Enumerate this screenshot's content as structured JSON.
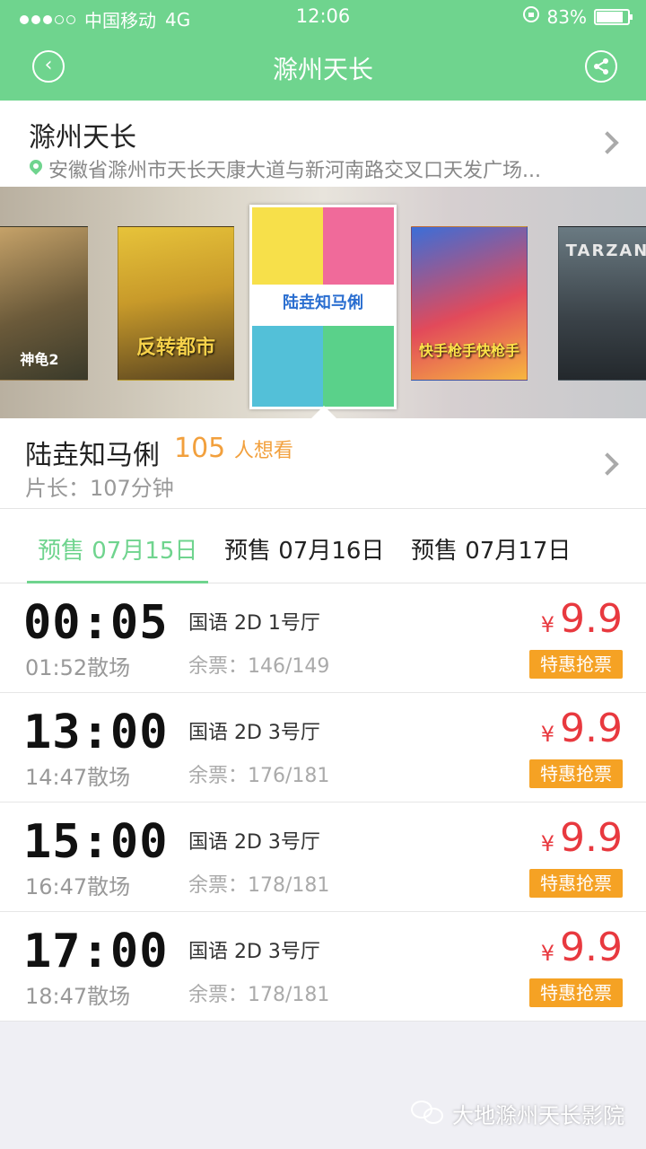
{
  "status_bar": {
    "carrier": "中国移动",
    "network": "4G",
    "time": "12:06",
    "battery": "83%"
  },
  "nav": {
    "title": "滁州天长"
  },
  "cinema": {
    "name": "滁州天长",
    "address": "安徽省滁州市天长天康大道与新河南路交叉口天发广场..."
  },
  "posters": [
    {
      "title": "神龟2"
    },
    {
      "title": "反转都市"
    },
    {
      "title": "陆垚知马俐"
    },
    {
      "title": "快手枪手快枪手"
    },
    {
      "title": "TARZAN"
    }
  ],
  "movie": {
    "name": "陆垚知马俐",
    "want_count": "105",
    "want_label": "人想看",
    "length": "片长：107分钟"
  },
  "tabs": [
    {
      "label": "预售 07月15日",
      "active": true
    },
    {
      "label": "预售 07月16日",
      "active": false
    },
    {
      "label": "预售 07月17日",
      "active": false
    }
  ],
  "sessions": [
    {
      "start": "00:05",
      "end": "01:52散场",
      "lang": "国语 2D  1号厅",
      "remain": "余票：146/149",
      "currency": "¥",
      "price": "9.9",
      "deal": "特惠抢票"
    },
    {
      "start": "13:00",
      "end": "14:47散场",
      "lang": "国语 2D  3号厅",
      "remain": "余票：176/181",
      "currency": "¥",
      "price": "9.9",
      "deal": "特惠抢票"
    },
    {
      "start": "15:00",
      "end": "16:47散场",
      "lang": "国语 2D  3号厅",
      "remain": "余票：178/181",
      "currency": "¥",
      "price": "9.9",
      "deal": "特惠抢票"
    },
    {
      "start": "17:00",
      "end": "18:47散场",
      "lang": "国语 2D  3号厅",
      "remain": "余票：178/181",
      "currency": "¥",
      "price": "9.9",
      "deal": "特惠抢票"
    }
  ],
  "watermark": {
    "text": "大地滁州天长影院"
  },
  "colors": {
    "accent": "#6fd48e",
    "price": "#e8393f",
    "deal": "#f5a224",
    "want": "#f2a03d"
  }
}
